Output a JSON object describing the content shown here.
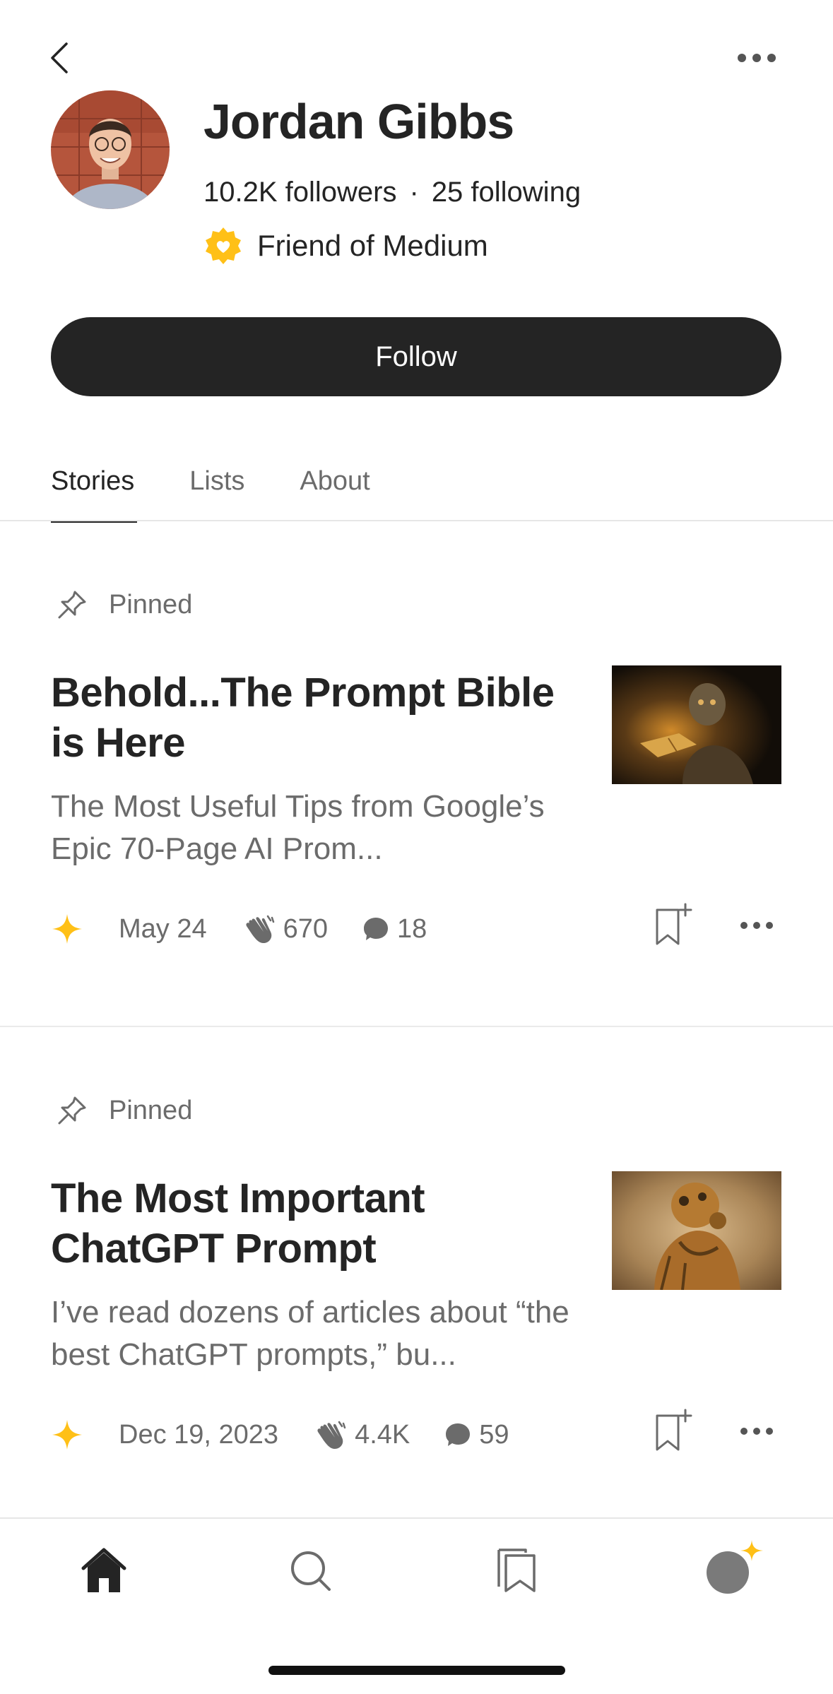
{
  "profile": {
    "name": "Jordan Gibbs",
    "followers": "10.2K followers",
    "separator": "·",
    "following": "25 following",
    "badge": "Friend of Medium",
    "follow_label": "Follow"
  },
  "tabs": [
    {
      "label": "Stories",
      "active": true
    },
    {
      "label": "Lists",
      "active": false
    },
    {
      "label": "About",
      "active": false
    }
  ],
  "stories": [
    {
      "pinned_label": "Pinned",
      "title": "Behold...The Prompt Bible is Here",
      "subtitle": "The Most Useful Tips from Google’s Epic 70-Page AI Prom...",
      "date": "May 24",
      "claps": "670",
      "responses": "18"
    },
    {
      "pinned_label": "Pinned",
      "title": "The Most Important ChatGPT Prompt",
      "subtitle": "I’ve read dozens of articles about “the best ChatGPT prompts,” bu...",
      "date": "Dec 19, 2023",
      "claps": "4.4K",
      "responses": "59"
    }
  ],
  "colors": {
    "text": "#242424",
    "muted": "#6b6b6b",
    "accent_star": "#FFC017",
    "button_bg": "#242424"
  },
  "icons": [
    "back-icon",
    "more-icon",
    "friend-badge-icon",
    "pin-icon",
    "member-star-icon",
    "clap-icon",
    "response-icon",
    "bookmark-add-icon",
    "home-icon",
    "search-icon",
    "library-icon",
    "profile-icon"
  ]
}
